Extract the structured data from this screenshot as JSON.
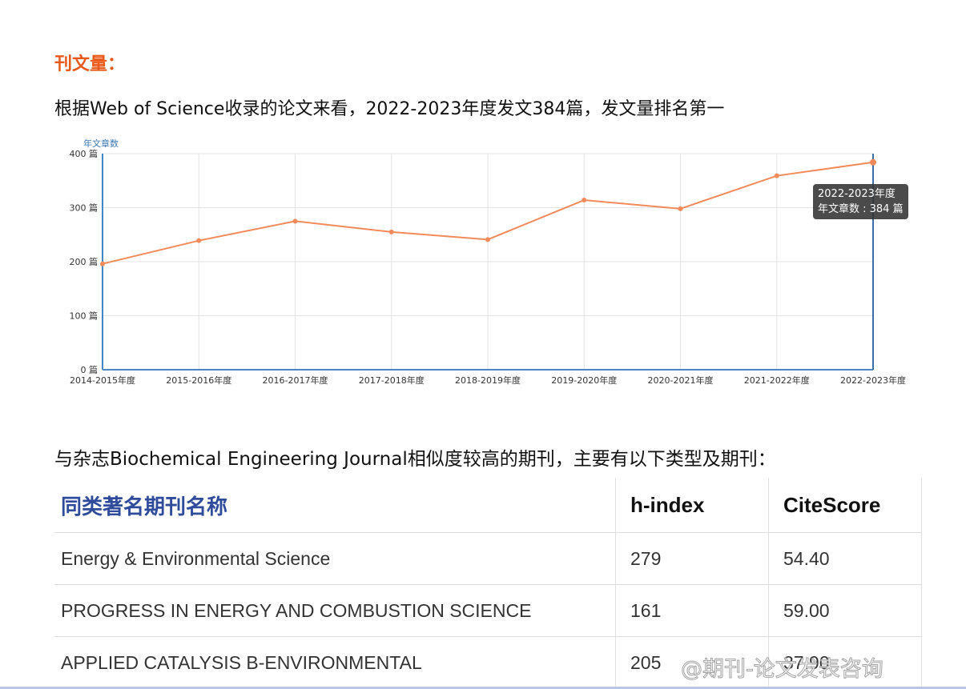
{
  "section_title": "刊文量：",
  "intro_text": "根据Web of Science收录的论文来看，2022-2023年度发文384篇，发文量排名第一",
  "chart_data": {
    "type": "line",
    "ylabel": "年文章数",
    "categories": [
      "2014-2015年度",
      "2015-2016年度",
      "2016-2017年度",
      "2017-2018年度",
      "2018-2019年度",
      "2019-2020年度",
      "2020-2021年度",
      "2021-2022年度",
      "2022-2023年度"
    ],
    "series": [
      {
        "name": "年文章数",
        "values": [
          196,
          239,
          275,
          255,
          241,
          314,
          298,
          359,
          384
        ]
      }
    ],
    "ylim": [
      0,
      400
    ],
    "yticks": [
      0,
      100,
      200,
      300,
      400
    ],
    "ytick_labels": [
      "0 篇",
      "100 篇",
      "200 篇",
      "300 篇",
      "400 篇"
    ],
    "grid": true,
    "line_color": "#f28a5b",
    "tooltip": {
      "title": "2022-2023年度",
      "label": "年文章数 : 384 篇"
    }
  },
  "similar_text": "与杂志Biochemical Engineering Journal相似度较高的期刊，主要有以下类型及期刊：",
  "table": {
    "headers": [
      "同类著名期刊名称",
      "h-index",
      "CiteScore"
    ],
    "rows": [
      [
        "Energy & Environmental Science",
        "279",
        "54.40"
      ],
      [
        "PROGRESS IN ENERGY AND COMBUSTION SCIENCE",
        "161",
        "59.00"
      ],
      [
        "APPLIED CATALYSIS B-ENVIRONMENTAL",
        "205",
        "37.90"
      ]
    ]
  },
  "watermark": "@期刊-论文发表咨询"
}
